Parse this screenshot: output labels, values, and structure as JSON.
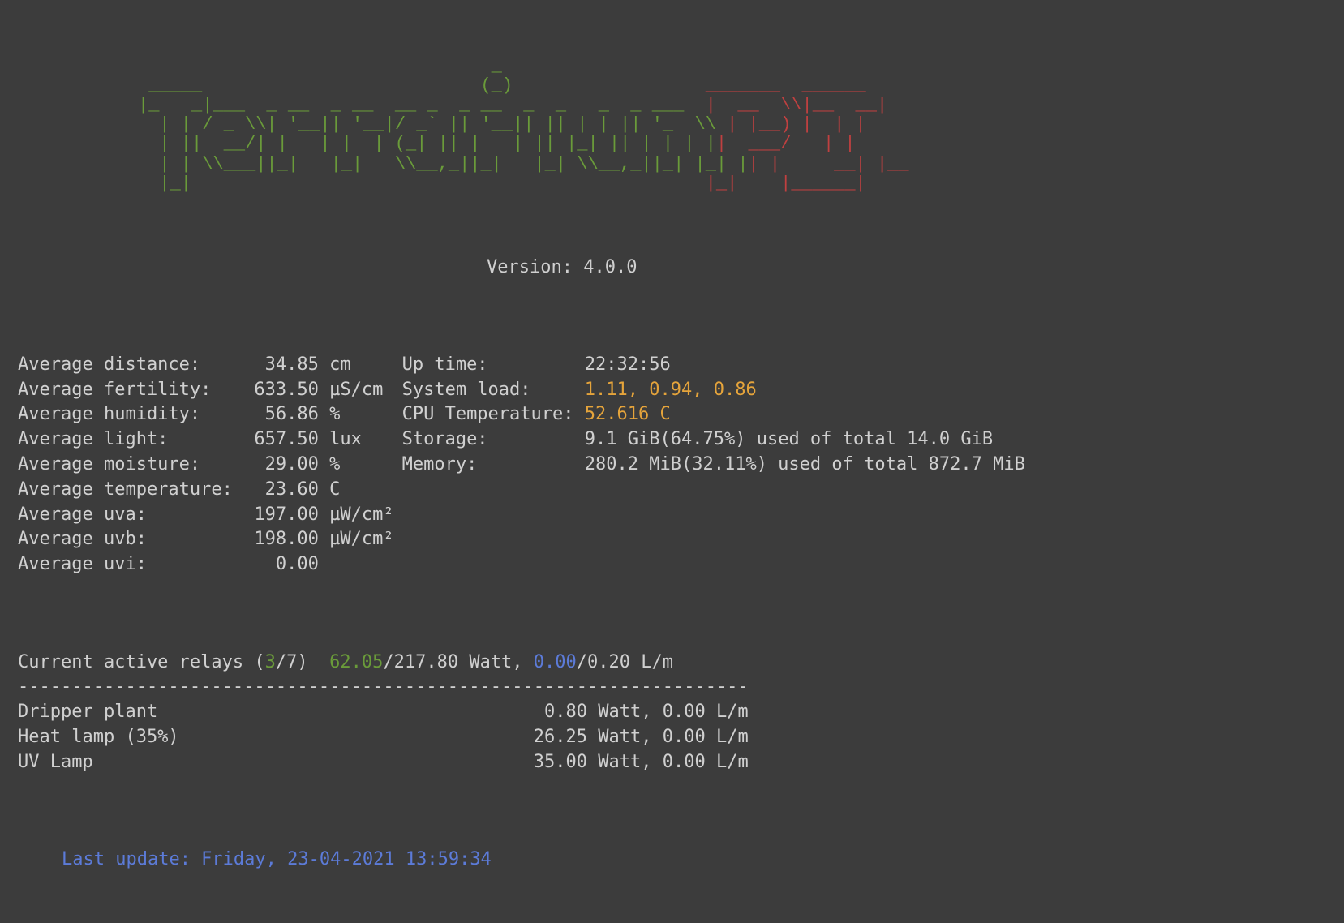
{
  "ascii_art_green": " _____                          _\n|_   _|__ _ __ _ __ __ _ _ __ (_)_   _ _ __ ___\n  | |/ _ \\ '__| '__/ _` | '__| | | | | | '_ ` _ \\\n  | |  __/ |  | | | (_| | |  | | |_| | | | | | |\n  |_|\\___|_|  |_|  \\__,_|_|  |_|\\__,_|_| |_| |_|",
  "ascii_art_red": " ____ ___\n|  _ \\_ _|\n| |_) | |\n|  __/| |\n|_|  |___|",
  "version_label": "Version: ",
  "version": "4.0.0",
  "left_col": {
    "distance_label": "Average distance:",
    "distance_value": "34.85 cm",
    "fertility_label": "Average fertility:",
    "fertility_value": "633.50 µS/cm",
    "humidity_label": "Average humidity:",
    "humidity_value": "56.86 %",
    "light_label": "Average light:",
    "light_value": "657.50 lux",
    "moisture_label": "Average moisture:",
    "moisture_value": "29.00 %",
    "temperature_label": "Average temperature:",
    "temperature_value": "23.60 C",
    "uva_label": "Average uva:",
    "uva_value": "197.00 µW/cm²",
    "uvb_label": "Average uvb:",
    "uvb_value": "198.00 µW/cm²",
    "uvi_label": "Average uvi:",
    "uvi_value": "0.00"
  },
  "right_col": {
    "uptime_label": "Up time:",
    "uptime_value": "22:32:56",
    "systemload_label": "System load:",
    "systemload_value": "1.11, 0.94, 0.86",
    "cputemp_label": "CPU Temperature:",
    "cputemp_value": "52.616 C",
    "storage_label": "Storage:",
    "storage_value": "9.1 GiB(64.75%) used of total 14.0 GiB",
    "memory_label": "Memory:",
    "memory_value": "280.2 MiB(32.11%) used of total 872.7 MiB"
  },
  "relays": {
    "prefix": "Current active relays (",
    "active": "3",
    "slash1": "/7)  ",
    "watt_active": "62.05",
    "watt_total": "/217.80 Watt, ",
    "flow_active": "0.00",
    "flow_total": "/0.20 L/m",
    "separator": "--------------------------------------------------------------------",
    "row1_name": "Dripper plant",
    "row1_vals": "0.80 Watt, 0.00 L/m",
    "row2_name": "Heat lamp (35%)",
    "row2_vals": "26.25 Watt, 0.00 L/m",
    "row3_name": "UV Lamp",
    "row3_vals": "35.00 Watt, 0.00 L/m"
  },
  "last_update": "Last update: Friday, 23-04-2021 13:59:34"
}
